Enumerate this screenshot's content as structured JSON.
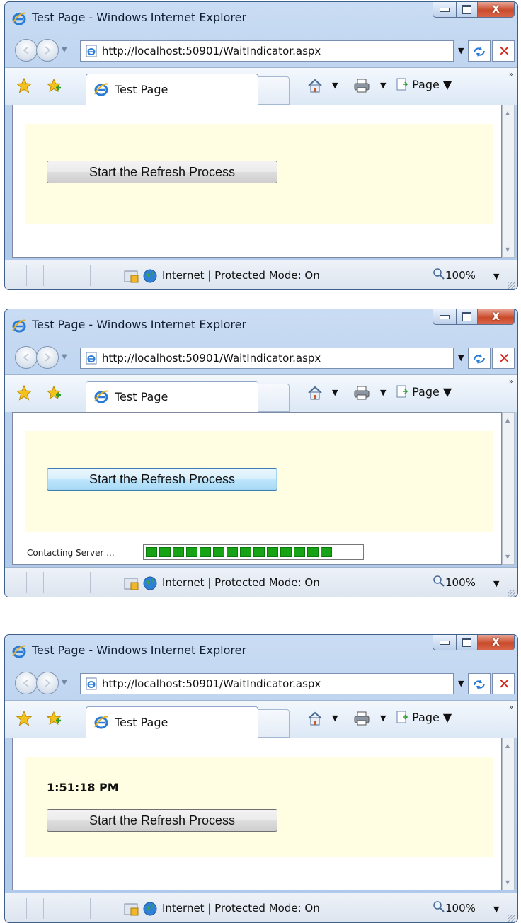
{
  "window": {
    "title": "Test Page - Windows Internet Explorer",
    "address": "http://localhost:50901/WaitIndicator.aspx",
    "tab_label": "Test Page",
    "page_menu": "Page",
    "status_zone": "Internet | Protected Mode: On",
    "zoom": "100%"
  },
  "icons": {
    "back": "back-arrow-icon",
    "forward": "forward-arrow-icon",
    "page_icon": "ie-page-icon",
    "refresh": "refresh-icon",
    "stop": "stop-x-icon",
    "favorites": "star-icon",
    "add_favorites": "add-favorites-icon",
    "home": "home-icon",
    "print": "printer-icon",
    "page": "page-icon",
    "shield": "protected-mode-shield-icon",
    "globe": "internet-globe-icon",
    "zoom": "magnifier-icon"
  },
  "colors": {
    "panel_bg": "#fffee2",
    "progress_green": "#16a316",
    "close_red": "#c94a2b"
  },
  "states": {
    "initial": {
      "button_label": "Start the Refresh Process"
    },
    "waiting": {
      "button_label": "Start the Refresh Process",
      "wait_label": "Contacting Server ...",
      "progress_segments_filled": 14,
      "progress_fraction": 0.86
    },
    "done": {
      "time_label": "1:51:18 PM",
      "button_label": "Start the Refresh Process"
    }
  }
}
